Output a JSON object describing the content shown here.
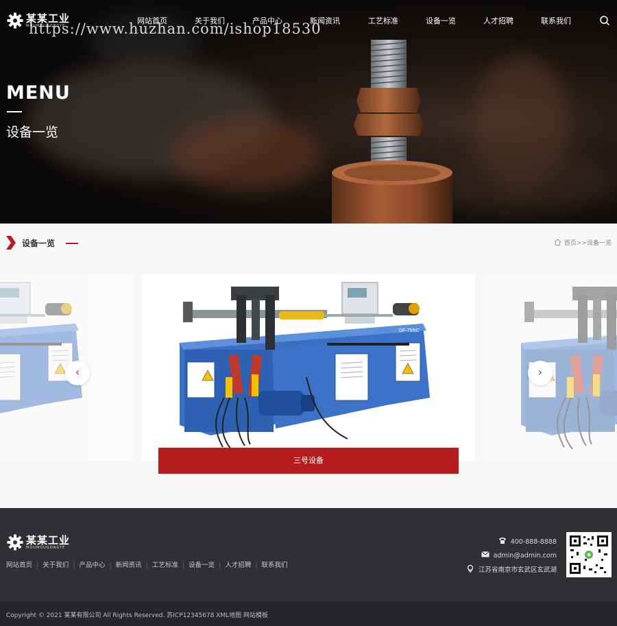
{
  "brand": {
    "name": "某某工业",
    "sub": "MOUMOUGONGYE"
  },
  "watermark": "https://www.huzhan.com/ishop18530",
  "nav": {
    "items": [
      "网站首页",
      "关于我们",
      "产品中心",
      "新闻资讯",
      "工艺标准",
      "设备一览",
      "人才招聘",
      "联系我们"
    ]
  },
  "hero": {
    "menu_title": "MENU",
    "menu_sub": "设备一览"
  },
  "section": {
    "title": "设备一览",
    "breadcrumb": "首页>>设备一览",
    "caption": "三号设备",
    "machine_label": "DF-75NC"
  },
  "footer": {
    "nav": [
      "网站首页",
      "关于我们",
      "产品中心",
      "新闻资讯",
      "工艺标准",
      "设备一览",
      "人才招聘",
      "联系我们"
    ],
    "phone": "400-888-8888",
    "email": "admin@admin.com",
    "address": "江苏省南京市玄武区玄武湖",
    "copyright": "Copyright © 2021 某某有限公司 All Rights Reserved. 苏ICP12345678 XML地图 网站模板"
  },
  "colors": {
    "accent": "#b71c1c",
    "footer_bg": "#2f3033",
    "machine_blue": "#3a6fc4"
  },
  "icons": [
    "gear-icon",
    "search-icon",
    "chevron-left-icon",
    "chevron-right-icon",
    "home-icon",
    "phone-icon",
    "mail-icon",
    "location-icon",
    "qr-code"
  ]
}
